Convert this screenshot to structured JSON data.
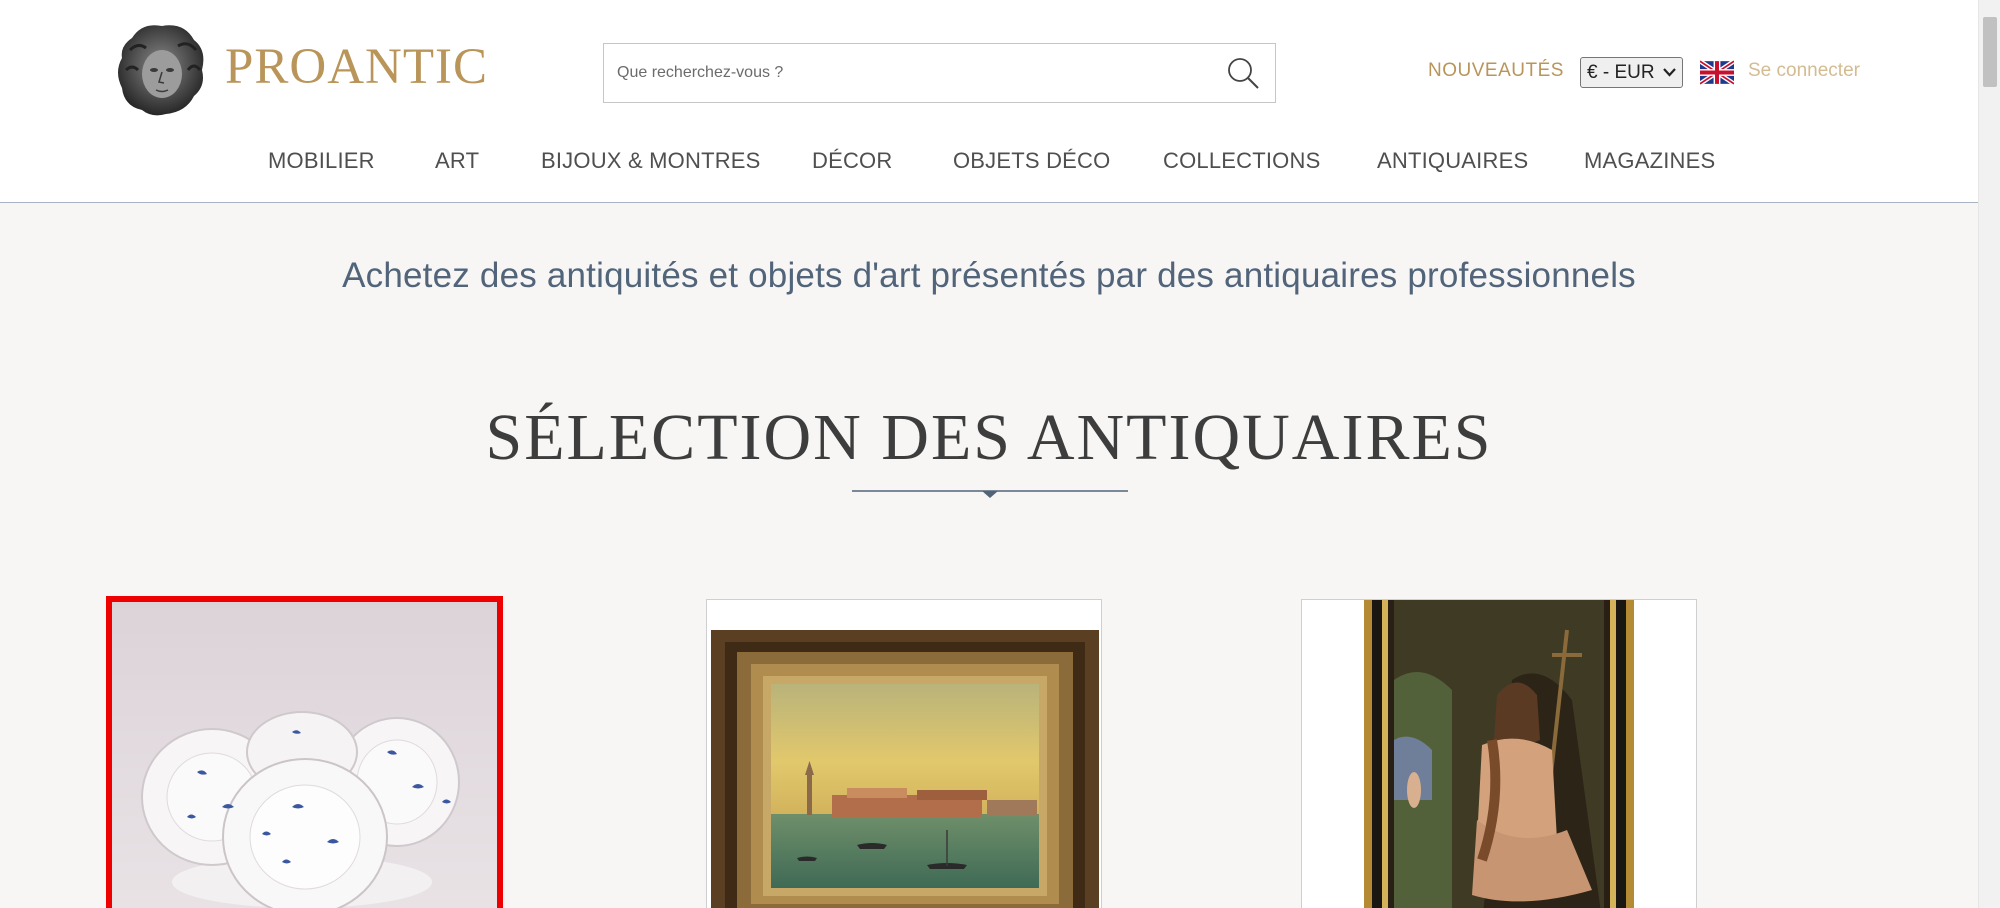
{
  "header": {
    "logo_text": "PROANTIC",
    "search": {
      "placeholder": "Que recherchez-vous ?",
      "value": ""
    },
    "nouveautes_label": "NOUVEAUTÉS",
    "currency_selected": "€ - EUR",
    "language_flag": "uk-flag-icon",
    "login_label": "Se connecter"
  },
  "nav": {
    "items": [
      {
        "label": "MOBILIER"
      },
      {
        "label": "ART"
      },
      {
        "label": "BIJOUX & MONTRES"
      },
      {
        "label": "DÉCOR"
      },
      {
        "label": "OBJETS DÉCO"
      },
      {
        "label": "COLLECTIONS"
      },
      {
        "label": "ANTIQUAIRES"
      },
      {
        "label": "MAGAZINES"
      }
    ]
  },
  "main": {
    "tagline": "Achetez des antiquités et objets d'art présentés par des antiquaires professionnels",
    "section_title": "SÉLECTION DES ANTIQUAIRES",
    "cards": [
      {
        "image": "porcelain-plates-image",
        "selected": true
      },
      {
        "image": "venice-painting-image",
        "selected": false
      },
      {
        "image": "saint-john-painting-image",
        "selected": false
      }
    ]
  },
  "colors": {
    "brand_gold": "#b9955a",
    "nav_text": "#4f4f4f",
    "tagline_blue": "#51647a",
    "selection_red": "#ee0000",
    "background": "#f7f6f5"
  },
  "icons": {
    "search": "search-icon",
    "logo": "logo-bust-icon",
    "dropdown": "chevron-down-icon"
  }
}
